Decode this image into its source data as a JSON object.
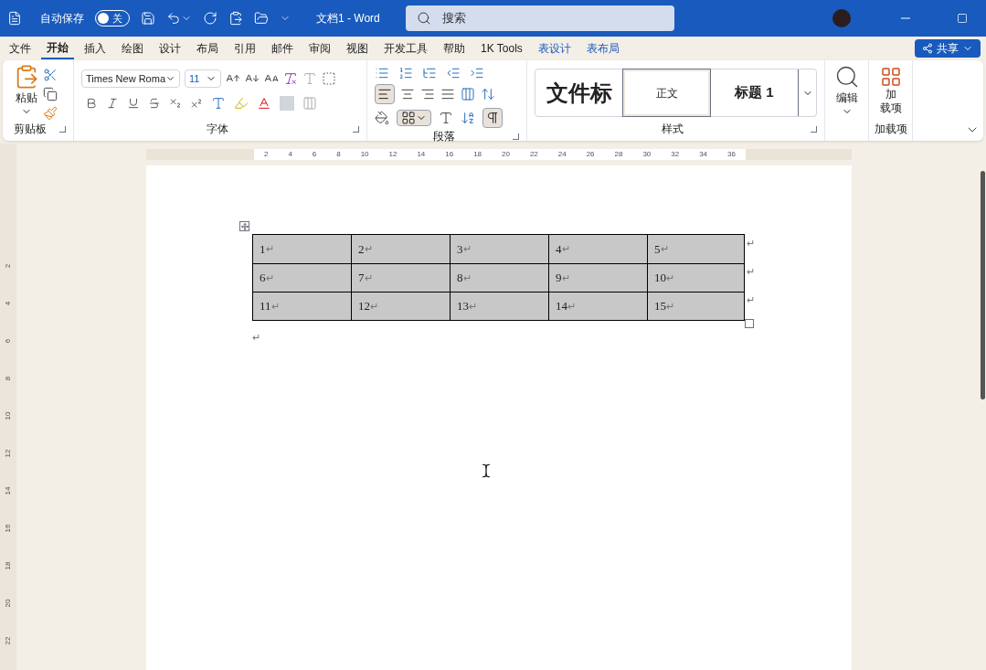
{
  "title_bar": {
    "autosave_label": "自动保存",
    "autosave_toggle": {
      "label": "关",
      "on": false
    },
    "document_title": "文档1 - Word",
    "search": {
      "placeholder": "搜索"
    }
  },
  "menu_tabs": [
    {
      "label": "文件",
      "selected": false,
      "kind": "normal"
    },
    {
      "label": "开始",
      "selected": true,
      "kind": "normal"
    },
    {
      "label": "插入",
      "selected": false,
      "kind": "normal"
    },
    {
      "label": "绘图",
      "selected": false,
      "kind": "normal"
    },
    {
      "label": "设计",
      "selected": false,
      "kind": "normal"
    },
    {
      "label": "布局",
      "selected": false,
      "kind": "normal"
    },
    {
      "label": "引用",
      "selected": false,
      "kind": "normal"
    },
    {
      "label": "邮件",
      "selected": false,
      "kind": "normal"
    },
    {
      "label": "审阅",
      "selected": false,
      "kind": "normal"
    },
    {
      "label": "视图",
      "selected": false,
      "kind": "normal"
    },
    {
      "label": "开发工具",
      "selected": false,
      "kind": "normal"
    },
    {
      "label": "帮助",
      "selected": false,
      "kind": "normal"
    },
    {
      "label": "1K Tools",
      "selected": false,
      "kind": "normal"
    },
    {
      "label": "表设计",
      "selected": false,
      "kind": "contextual"
    },
    {
      "label": "表布局",
      "selected": false,
      "kind": "contextual"
    }
  ],
  "share_button": "共享",
  "ribbon": {
    "clipboard": {
      "paste": "粘贴",
      "group_label": "剪贴板"
    },
    "font": {
      "font_name": "Times New Roma",
      "font_size": "11",
      "group_label": "字体"
    },
    "paragraph": {
      "group_label": "段落"
    },
    "styles": {
      "items": [
        {
          "label": "文件标",
          "kind": "title",
          "selected": false
        },
        {
          "label": "正文",
          "kind": "body",
          "selected": true
        },
        {
          "label": "标题 1",
          "kind": "heading",
          "selected": false
        }
      ],
      "group_label": "样式"
    },
    "editing": {
      "label": "编辑"
    },
    "addins": {
      "button_lines": [
        "加",
        "载项"
      ],
      "group_label": "加载项"
    }
  },
  "ruler": {
    "labels": [
      "2",
      "4",
      "6",
      "8",
      "10",
      "12",
      "14",
      "16",
      "18",
      "20",
      "22",
      "24",
      "26",
      "28",
      "30",
      "32",
      "34",
      "36"
    ]
  },
  "vertical_ruler": {
    "labels": [
      "2",
      "4",
      "6",
      "8",
      "10",
      "12",
      "14",
      "16",
      "18",
      "20",
      "22"
    ]
  },
  "table": {
    "selected": true,
    "rows": [
      [
        {
          "text": "1",
          "mark": "↵"
        },
        {
          "text": "2",
          "mark": "↵"
        },
        {
          "text": "3",
          "mark": "↵"
        },
        {
          "text": "4",
          "mark": "↵"
        },
        {
          "text": "5",
          "mark": "↵"
        }
      ],
      [
        {
          "text": "6",
          "mark": "↵"
        },
        {
          "text": "7",
          "mark": "↵"
        },
        {
          "text": "8",
          "mark": "↵"
        },
        {
          "text": "9",
          "mark": "↵"
        },
        {
          "text": "10",
          "mark": "↵"
        }
      ],
      [
        {
          "text": "11",
          "mark": "↵"
        },
        {
          "text": "12",
          "mark": "↵"
        },
        {
          "text": "13",
          "mark": "↵"
        },
        {
          "text": "14",
          "mark": "↵"
        },
        {
          "text": "15",
          "mark": "↵"
        }
      ]
    ],
    "row_end_marks": [
      "↵",
      "↵",
      "↵"
    ]
  },
  "after_table_mark": "↵"
}
